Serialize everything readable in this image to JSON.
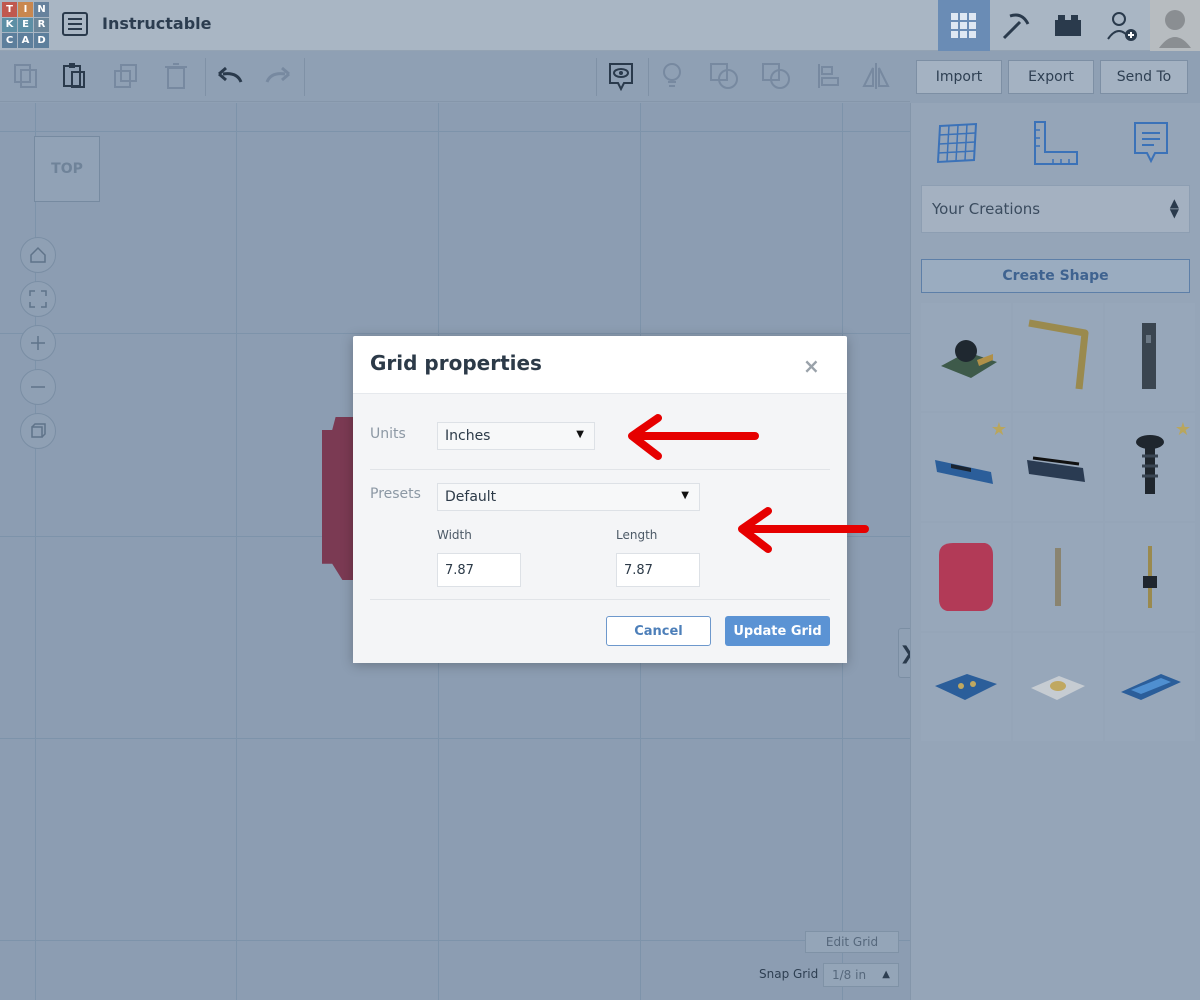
{
  "app": {
    "logo_letters": [
      "T",
      "I",
      "N",
      "K",
      "E",
      "R",
      "C",
      "A",
      "D"
    ],
    "design_title": "Instructable"
  },
  "topbar": {
    "icons": [
      "3d-design-grid-icon",
      "circuits-pickaxe-icon",
      "codeblocks-bricks-icon",
      "add-user-icon",
      "user-avatar"
    ]
  },
  "toolbar": {
    "tools": [
      "copy-icon",
      "paste-icon",
      "duplicate-icon",
      "delete-icon",
      "undo-icon",
      "redo-icon",
      "notes-visibility-icon",
      "light-bulb-icon",
      "group-icon",
      "ungroup-icon",
      "align-icon",
      "mirror-icon"
    ],
    "import_label": "Import",
    "export_label": "Export",
    "send_to_label": "Send To"
  },
  "workplane": {
    "view_cube_label": "TOP",
    "view_controls": [
      "home-view-icon",
      "fit-view-icon",
      "zoom-in-icon",
      "zoom-out-icon",
      "perspective-icon"
    ],
    "edit_grid_label": "Edit Grid",
    "snap_grid_label": "Snap Grid",
    "snap_grid_value": "1/8 in"
  },
  "side_panel": {
    "tabs": [
      "workplane-icon",
      "ruler-icon",
      "notes-icon"
    ],
    "library_select": "Your Creations",
    "create_shape_label": "Create Shape",
    "starred_cells": [
      3,
      5
    ]
  },
  "dialog": {
    "title": "Grid properties",
    "close_symbol": "×",
    "units_label": "Units",
    "units_value": "Inches",
    "presets_label": "Presets",
    "presets_value": "Default",
    "width_label": "Width",
    "width_value": "7.87",
    "length_label": "Length",
    "length_value": "7.87",
    "cancel_label": "Cancel",
    "update_label": "Update Grid"
  },
  "colors": {
    "annotation_arrow": "#e60000",
    "primary_button": "#5b93d4",
    "overlay_tint": "#8fa0b4"
  }
}
